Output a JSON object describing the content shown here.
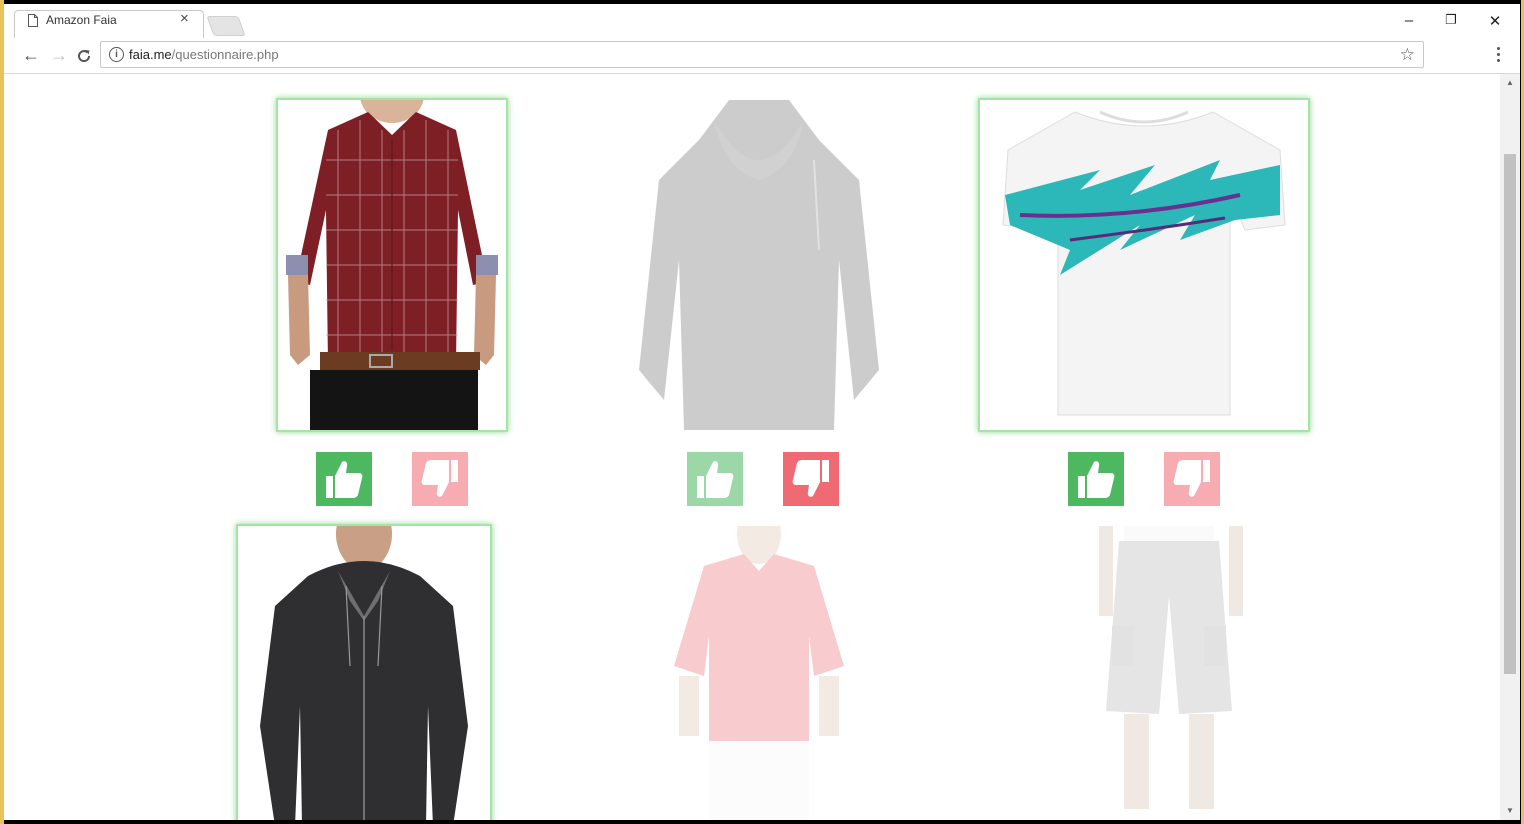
{
  "browser": {
    "tab_title": "Amazon Faia",
    "tab_close": "×",
    "url_host": "faia.me",
    "url_path": "/questionnaire.php",
    "controls": {
      "minimize": "–",
      "restore": "❐",
      "close": "✕"
    },
    "nav": {
      "back": "←",
      "forward": "→",
      "reload": "C"
    },
    "star": "☆"
  },
  "products": [
    {
      "name": "red-plaid-shirt",
      "selected": true,
      "vote_up_faded": false,
      "vote_down_faded": true
    },
    {
      "name": "black-cowl-sweater",
      "selected": false,
      "vote_up_faded": true,
      "vote_down_faded": false
    },
    {
      "name": "jazz-print-tshirt",
      "selected": true,
      "vote_up_faded": false,
      "vote_down_faded": true
    },
    {
      "name": "black-zip-hoodie",
      "selected": true
    },
    {
      "name": "red-polo-shirt",
      "selected": false
    },
    {
      "name": "grey-cargo-shorts",
      "selected": false
    }
  ],
  "colors": {
    "like": "#4db860",
    "dislike": "#f06a73",
    "selected_glow": "#8fd88f"
  }
}
